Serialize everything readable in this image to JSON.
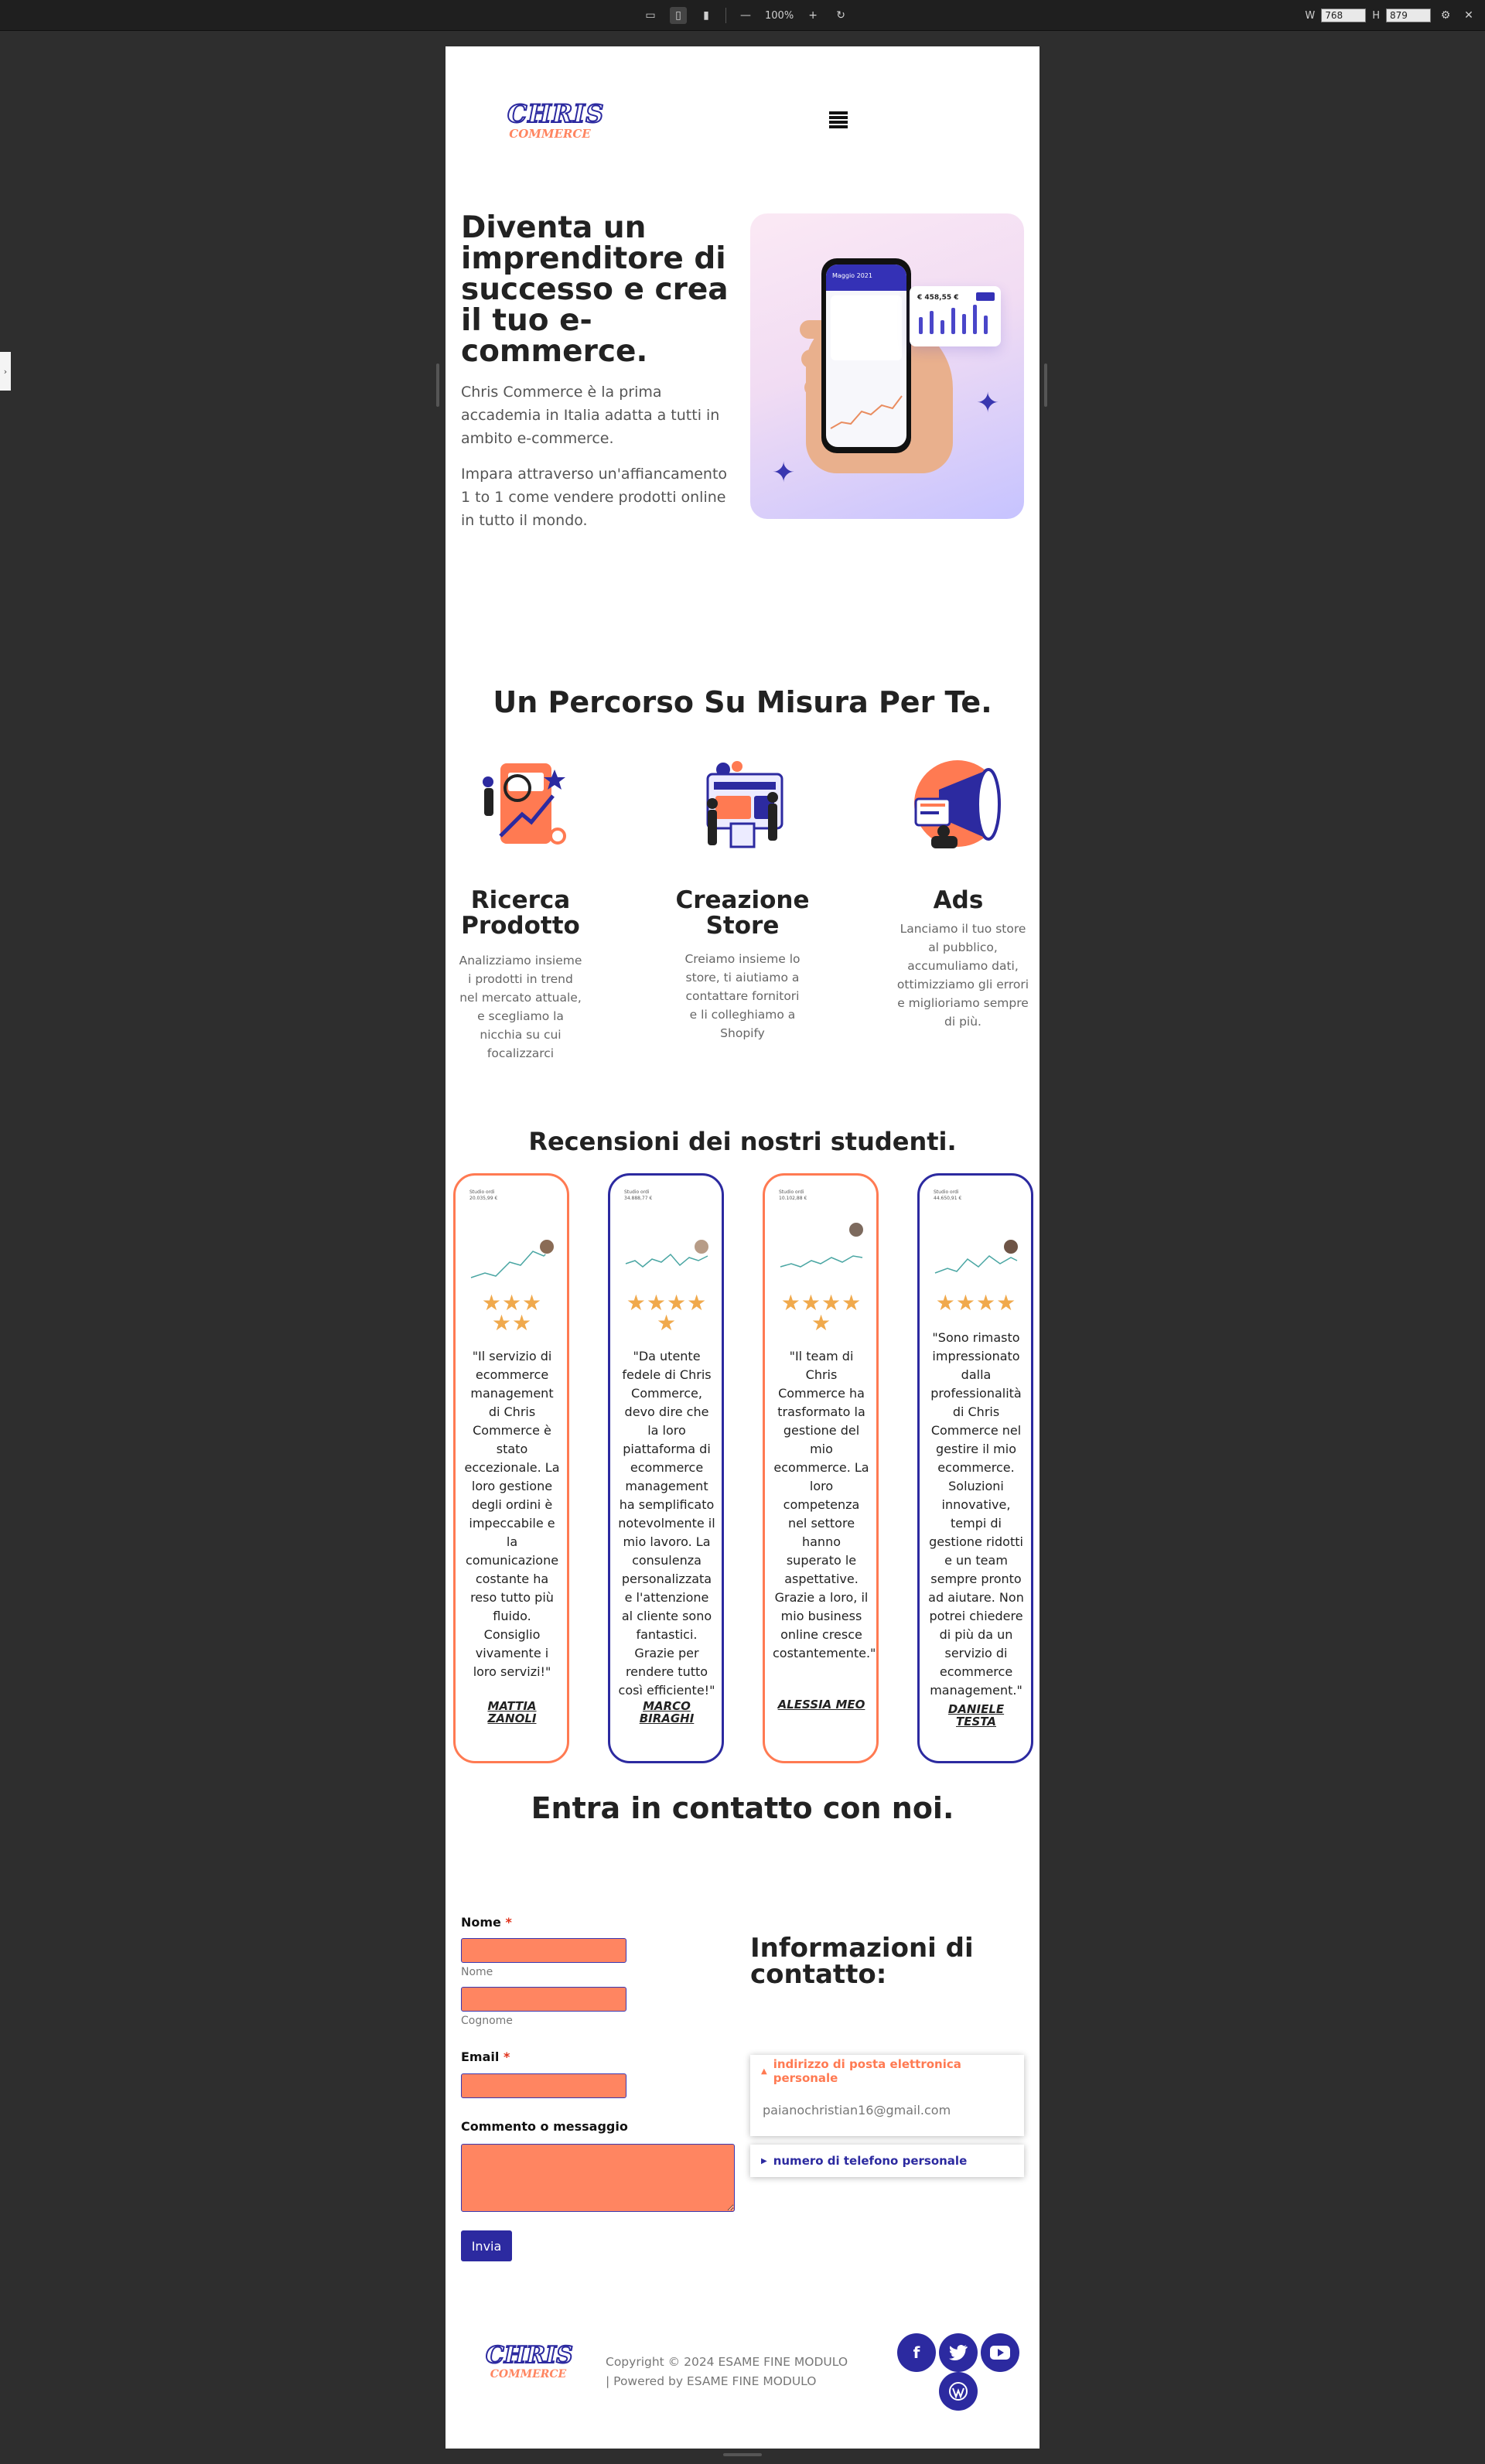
{
  "toolbar": {
    "zoom": "100%",
    "width_label": "W",
    "width_value": "768",
    "height_label": "H",
    "height_value": "879"
  },
  "logo": {
    "line1": "CHRIS",
    "line2": "COMMERCE"
  },
  "hero": {
    "title": "Diventa un imprenditore di successo e crea il tuo e-commerce.",
    "p1": "Chris Commerce è la prima accademia in Italia adatta a tutti in ambito e-commerce.",
    "p2": "Impara attraverso un'affiancamento 1 to 1 come vendere prodotti online in tutto il mondo.",
    "phone_header": "Maggio 2021",
    "card_amount": "€ 458,55 €"
  },
  "percorso": {
    "title": "Un Percorso Su Misura Per Te.",
    "features": [
      {
        "title": "Ricerca Prodotto",
        "text": "Analizziamo insieme i prodotti in trend nel mercato attuale, e scegliamo la nicchia su cui focalizzarci"
      },
      {
        "title": "Creazione Store",
        "text": "Creiamo insieme lo store, ti aiutiamo a contattare fornitori e li colleghiamo a Shopify"
      },
      {
        "title": "Ads",
        "text": "Lanciamo il tuo store al pubblico, accumuliamo dati, ottimizziamo gli errori e miglioriamo sempre di più."
      }
    ]
  },
  "reviews": {
    "title": "Recensioni dei nostri studenti.",
    "items": [
      {
        "shot_title": "Studio ordi\n20.035,99 €",
        "stars": "★★★\n★★",
        "text": "\"Il servizio di ecommerce management di Chris Commerce è stato eccezionale. La loro gestione degli ordini è impeccabile e la comunicazione costante ha reso tutto più fluido. Consiglio vivamente i loro servizi!\"",
        "name": "MATTIA ZANOLI"
      },
      {
        "shot_title": "Studio ordi\n34.888,77 €",
        "stars": "★★★★\n★",
        "text": "\"Da utente fedele di Chris Commerce, devo dire che la loro piattaforma di ecommerce management ha semplificato notevolmente il mio lavoro. La consulenza personalizzata e l'attenzione al cliente sono fantastici. Grazie per rendere tutto così efficiente!\"",
        "name": "MARCO BIRAGHI"
      },
      {
        "shot_title": "Studio ordi\n10.102,88 €",
        "stars": "★★★★\n★",
        "text": "\"Il team di Chris Commerce ha trasformato la gestione del mio ecommerce. La loro competenza nel settore hanno superato le aspettative. Grazie a loro, il mio business online cresce costantemente.\"",
        "name": "ALESSIA MEO"
      },
      {
        "shot_title": "Studio ordi\n44.650,91 €",
        "stars": "★★★★",
        "text": "\"Sono rimasto impressionato dalla professionalità di Chris Commerce nel gestire il mio ecommerce. Soluzioni innovative, tempi di gestione ridotti e un team sempre pronto ad aiutare. Non potrei chiedere di più da un servizio di ecommerce management.\"",
        "name": "DANIELE TESTA"
      }
    ]
  },
  "contact": {
    "title": "Entra in contatto con noi.",
    "name_label": "Nome",
    "required_mark": "*",
    "first_sub": "Nome",
    "last_sub": "Cognome",
    "email_label": "Email",
    "message_label": "Commento o messaggio",
    "submit": "Invia",
    "info_title": "Informazioni di contatto:",
    "email_section": "indirizzo di posta elettronica personale",
    "email_value": "paianochristian16@gmail.com",
    "phone_section": "numero di telefono personale"
  },
  "footer": {
    "copyright": "Copyright © 2024 ESAME FINE MODULO | Powered by ESAME FINE MODULO"
  },
  "colors": {
    "brand_blue": "#2c2aa0",
    "accent_orange": "#ff8561",
    "star": "#f0a94c"
  },
  "icons": [
    "desktop-icon",
    "tablet-icon",
    "mobile-icon",
    "minus-icon",
    "plus-icon",
    "reset-icon",
    "gear-icon",
    "close-icon",
    "hamburger-menu-icon",
    "facebook-icon",
    "twitter-icon",
    "youtube-icon",
    "wordpress-icon"
  ]
}
